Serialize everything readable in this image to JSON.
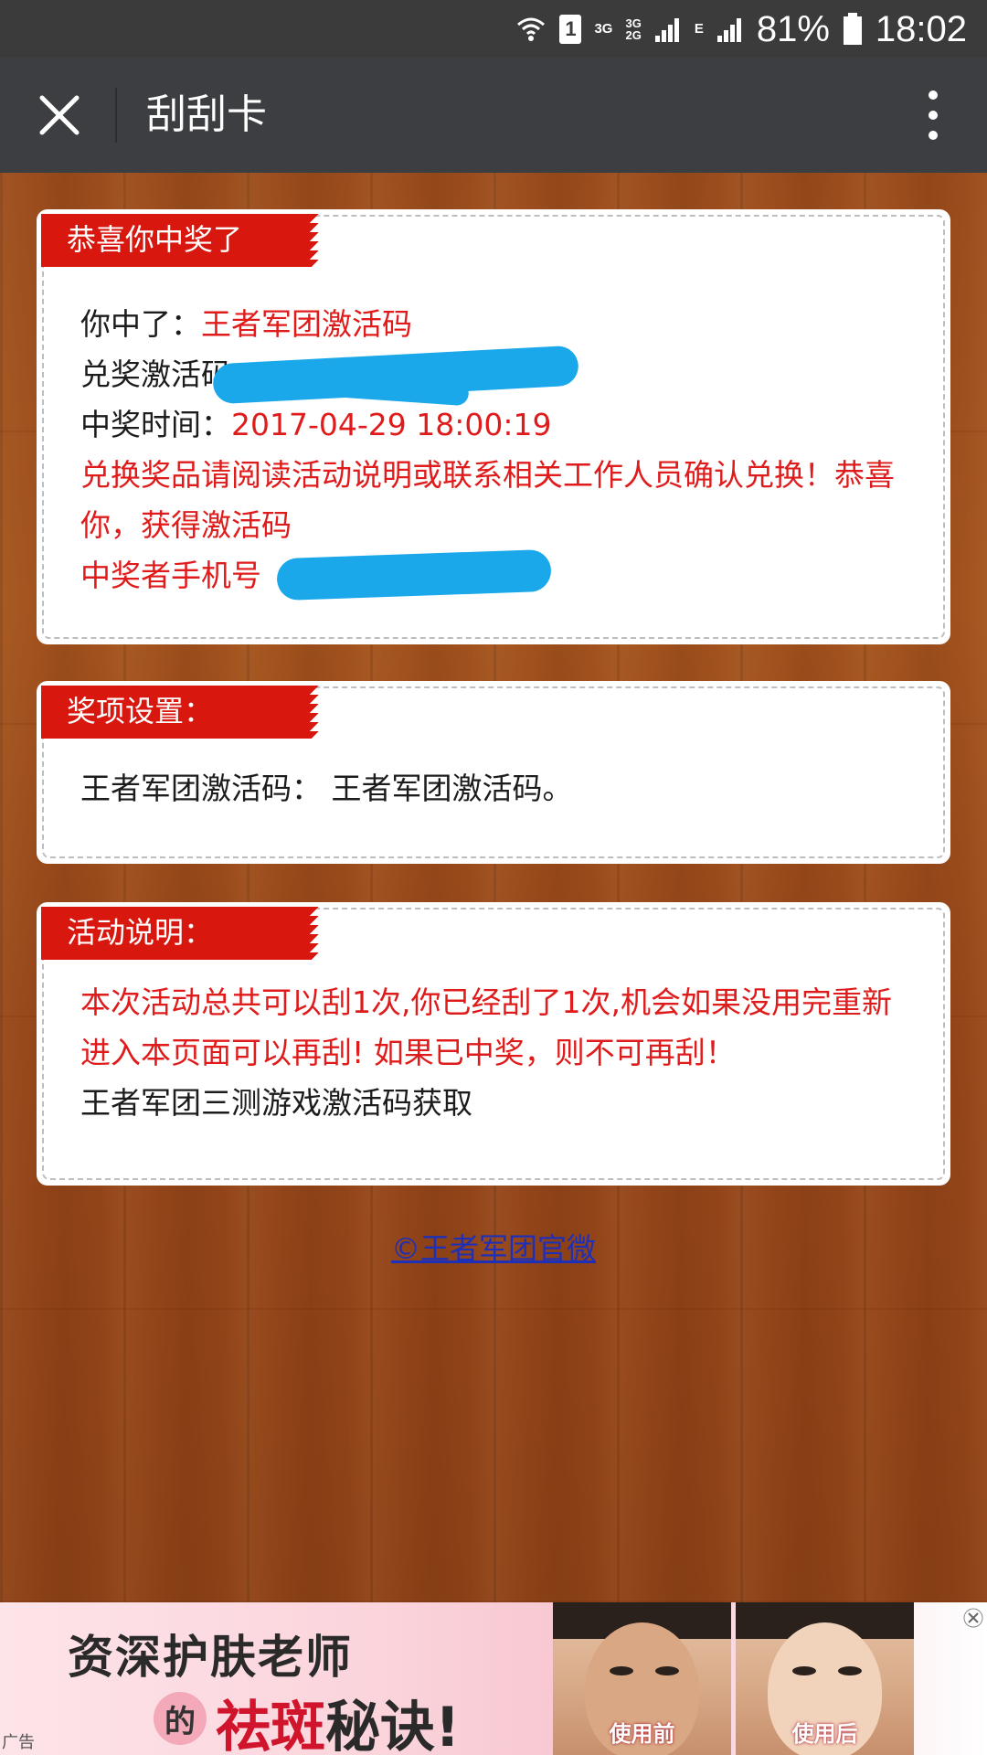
{
  "status_bar": {
    "sim_label": "1",
    "net_3g": "3G",
    "net_3g_top": "3G",
    "net_2g_bottom": "2G",
    "net_e": "E",
    "battery_percent": "81%",
    "time": "18:02",
    "icons": [
      "wifi-icon",
      "sim-icon",
      "signal-icon",
      "battery-icon"
    ]
  },
  "title_bar": {
    "title": "刮刮卡",
    "close_icon": "close-icon",
    "more_icon": "more-vertical-icon"
  },
  "prize_card": {
    "tag": "恭喜你中奖了",
    "won_label": "你中了：",
    "won_value": "王者军团激活码",
    "code_label": "兑奖激活码",
    "time_label": "中奖时间：",
    "time_value": "2017-04-29 18:00:19",
    "notice": "兑换奖品请阅读活动说明或联系相关工作人员确认兑换！恭喜你，获得激活码",
    "phone_label": "中奖者手机号"
  },
  "settings_card": {
    "tag": "奖项设置：",
    "line": "王者军团激活码： 王者军团激活码。"
  },
  "rules_card": {
    "tag": "活动说明：",
    "rule_text": "本次活动总共可以刮1次,你已经刮了1次,机会如果没用完重新进入本页面可以再刮! 如果已中奖，则不可再刮！",
    "extra_text": "王者军团三测游戏激活码获取"
  },
  "footer": {
    "link_text": "©王者军团官微"
  },
  "ad": {
    "label": "广告",
    "headline": "资深护肤老师",
    "de_char": "的",
    "sub_accent": "祛斑",
    "sub_rest": "秘诀!",
    "before_caption": "使用前",
    "after_caption": "使用后",
    "close_icon": "close-icon"
  },
  "colors": {
    "status_bar_bg": "#3b3b3b",
    "title_bar_bg": "#3d3e42",
    "tag_red": "#d8170f",
    "text_red": "#e01b1b",
    "redaction_blue": "#1aa8ea",
    "link_blue": "#1e2fb8"
  }
}
